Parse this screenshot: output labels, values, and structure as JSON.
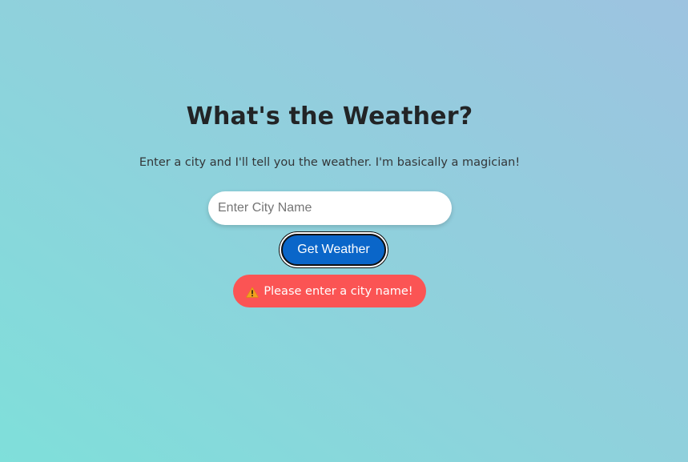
{
  "app": {
    "title": "What's the Weather?",
    "subtitle": "Enter a city and I'll tell you the weather. I'm basically a magician!"
  },
  "search": {
    "placeholder": "Enter City Name",
    "value": ""
  },
  "button": {
    "label": "Get Weather"
  },
  "error": {
    "icon": "warning-icon",
    "message": "Please enter a city name!"
  },
  "colors": {
    "button_bg": "#0a66c9",
    "error_bg": "#fb5454",
    "warning_icon": "#f0a21e"
  }
}
